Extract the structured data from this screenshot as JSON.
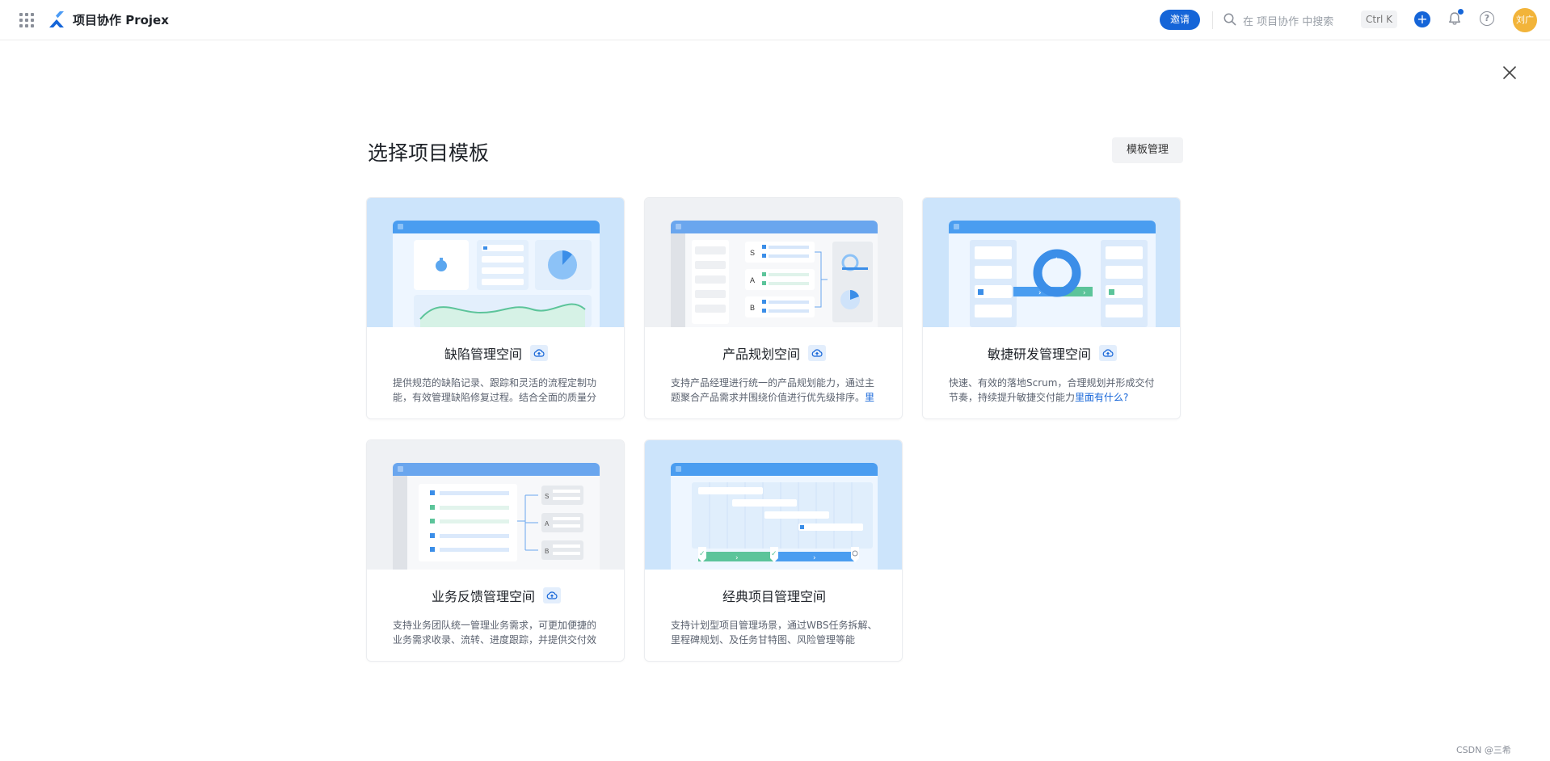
{
  "header": {
    "app_title": "项目协作 Projex",
    "invite_label": "邀请",
    "search_placeholder": "在 项目协作 中搜索",
    "shortcut": "Ctrl K",
    "avatar_text": "刘广",
    "icons": [
      "apps-grid-icon",
      "projex-logo-icon",
      "search-icon",
      "plus-icon",
      "bell-icon",
      "help-icon"
    ],
    "accent_color": "#1565d8"
  },
  "page": {
    "title": "选择项目模板",
    "template_manage_label": "模板管理"
  },
  "templates": [
    {
      "title": "缺陷管理空间",
      "has_cloud_badge": true,
      "desc": "提供规范的缺陷记录、跟踪和灵活的流程定制功能，有效管理缺陷修复过程。结合全面的质量分",
      "more": ""
    },
    {
      "title": "产品规划空间",
      "has_cloud_badge": true,
      "desc": "支持产品经理进行统一的产品规划能力，通过主题聚合产品需求并围绕价值进行优先级排序。",
      "more": "里"
    },
    {
      "title": "敏捷研发管理空间",
      "has_cloud_badge": true,
      "desc": "快速、有效的落地Scrum，合理规划并形成交付节奏，持续提升敏捷交付能力",
      "more": "里面有什么?"
    },
    {
      "title": "业务反馈管理空间",
      "has_cloud_badge": true,
      "desc": "支持业务团队统一管理业务需求，可更加便捷的业务需求收录、流转、进度跟踪，并提供交付效",
      "more": ""
    },
    {
      "title": "经典项目管理空间",
      "has_cloud_badge": false,
      "desc": "支持计划型项目管理场景，通过WBS任务拆解、里程碑规划、及任务甘特图、风险管理等能",
      "more": ""
    }
  ],
  "illus": {
    "agile_labels": [
      "‹",
      "›",
      "›"
    ],
    "product_labels": [
      "S",
      "A",
      "B"
    ],
    "feedback_labels": [
      "S",
      "A",
      "B"
    ],
    "gantt_marks": [
      "✓",
      "✓",
      "›",
      "›"
    ]
  },
  "watermark": "CSDN @三希"
}
